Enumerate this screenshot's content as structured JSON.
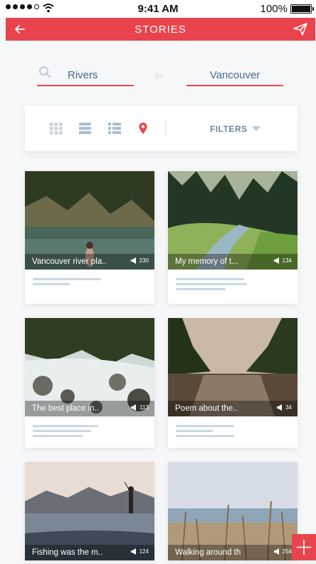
{
  "status_bar": {
    "time": "9:41 AM",
    "battery": "100%"
  },
  "app_bar": {
    "title": "STORIES"
  },
  "search": {
    "query": "Rivers",
    "connector": "in",
    "location": "Vancouver"
  },
  "toolbar": {
    "filters_label": "FILTERS"
  },
  "colors": {
    "accent": "#e9444d",
    "text_blue": "#4a6a8a",
    "line": "#c9d8e8"
  },
  "stories": [
    {
      "caption": "Vancouver river pla..",
      "count": "230",
      "scene": "lake"
    },
    {
      "caption": "My memory of t...",
      "count": "134",
      "scene": "forest"
    },
    {
      "caption": "The best place in..",
      "count": "113",
      "scene": "rapids"
    },
    {
      "caption": "Poem about the..",
      "count": "34",
      "scene": "river"
    },
    {
      "caption": "Fishing was the m..",
      "count": "124",
      "scene": "fishing"
    },
    {
      "caption": "Walking around th",
      "count": "254",
      "scene": "reeds"
    }
  ],
  "icons": {
    "back": "arrow-left-icon",
    "send": "paper-plane-icon",
    "search": "search-icon",
    "grid": "grid-view-icon",
    "list": "list-view-icon",
    "detail_list": "detail-list-icon",
    "map": "map-pin-icon",
    "caret": "caret-down-icon",
    "stat": "megaphone-icon",
    "add": "plus-icon"
  }
}
